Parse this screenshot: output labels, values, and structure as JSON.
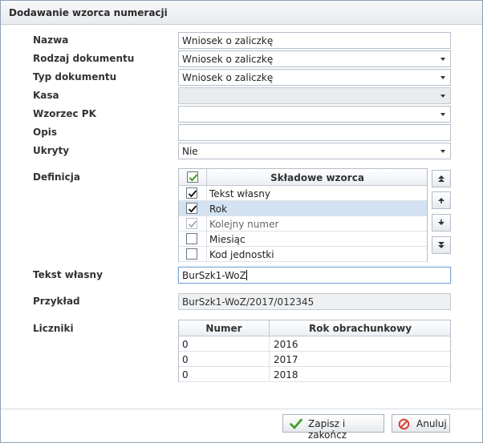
{
  "dialog": {
    "title": "Dodawanie wzorca numeracji"
  },
  "form": {
    "nazwa": {
      "label": "Nazwa",
      "value": "Wniosek o zaliczkę"
    },
    "rodzaj": {
      "label": "Rodzaj dokumentu",
      "value": "Wniosek o zaliczkę"
    },
    "typ": {
      "label": "Typ dokumentu",
      "value": "Wniosek o zaliczkę"
    },
    "kasa": {
      "label": "Kasa",
      "value": ""
    },
    "wzorzec_pk": {
      "label": "Wzorzec PK",
      "value": ""
    },
    "opis": {
      "label": "Opis",
      "value": ""
    },
    "ukryty": {
      "label": "Ukryty",
      "value": "Nie"
    }
  },
  "definicja": {
    "label": "Definicja",
    "header": "Składowe wzorca",
    "rows": [
      {
        "text": "Tekst własny",
        "checked": true,
        "disabled": false,
        "selected": false
      },
      {
        "text": "Rok",
        "checked": true,
        "disabled": false,
        "selected": true
      },
      {
        "text": "Kolejny numer",
        "checked": true,
        "disabled": true,
        "selected": false
      },
      {
        "text": "Miesiąc",
        "checked": false,
        "disabled": false,
        "selected": false
      },
      {
        "text": "Kod jednostki",
        "checked": false,
        "disabled": false,
        "selected": false
      }
    ]
  },
  "tekst_wlasny": {
    "label": "Tekst własny",
    "value": "BurSzk1-WoZ"
  },
  "przyklad": {
    "label": "Przykład",
    "value": "BurSzk1-WoZ/2017/012345"
  },
  "liczniki": {
    "label": "Liczniki",
    "headers": [
      "Numer",
      "Rok obrachunkowy"
    ],
    "rows": [
      [
        "0",
        "2016"
      ],
      [
        "0",
        "2017"
      ],
      [
        "0",
        "2018"
      ]
    ]
  },
  "buttons": {
    "save": "Zapisz i zakończ",
    "cancel": "Anuluj"
  },
  "colors": {
    "accent": "#d3e2f2",
    "check_green": "#3a9a1e",
    "cancel_red": "#d9422f"
  }
}
